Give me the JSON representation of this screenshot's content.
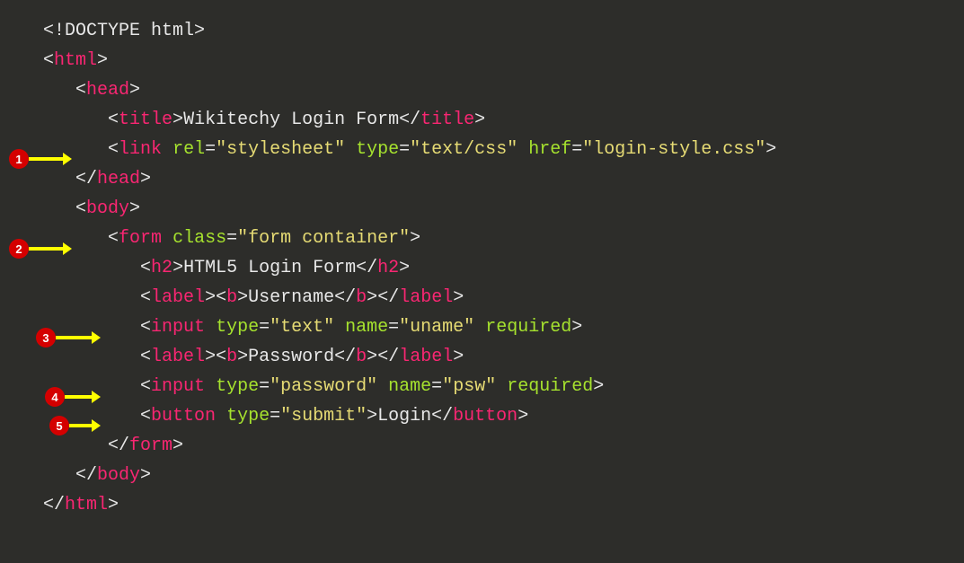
{
  "markers": {
    "m1": "1",
    "m2": "2",
    "m3": "3",
    "m4": "4",
    "m5": "5"
  },
  "code": {
    "doctype_open": "<!",
    "doctype": "DOCTYPE",
    "doctype_html": " html",
    "gt": ">",
    "lt": "<",
    "lt_close": "</",
    "space": " ",
    "eq": "=",
    "tag_html": "html",
    "tag_head": "head",
    "tag_title": "title",
    "title_text": "Wikitechy Login Form",
    "tag_link": "link",
    "attr_rel": "rel",
    "val_stylesheet": "\"stylesheet\"",
    "attr_type": "type",
    "val_textcss": "\"text/css\"",
    "attr_href": "href",
    "val_loginstyle": "\"login-style.css\"",
    "tag_body": "body",
    "tag_form": "form",
    "attr_class": "class",
    "val_formcontainer": "\"form container\"",
    "tag_h2": "h2",
    "h2_text": "HTML5 Login Form",
    "tag_label": "label",
    "tag_b": "b",
    "username_text": "Username",
    "tag_input": "input",
    "val_text": "\"text\"",
    "attr_name": "name",
    "val_uname": "\"uname\"",
    "attr_required": "required",
    "password_text": "Password",
    "val_password": "\"password\"",
    "val_psw": "\"psw\"",
    "tag_button": "button",
    "val_submit": "\"submit\"",
    "login_text": "Login"
  }
}
